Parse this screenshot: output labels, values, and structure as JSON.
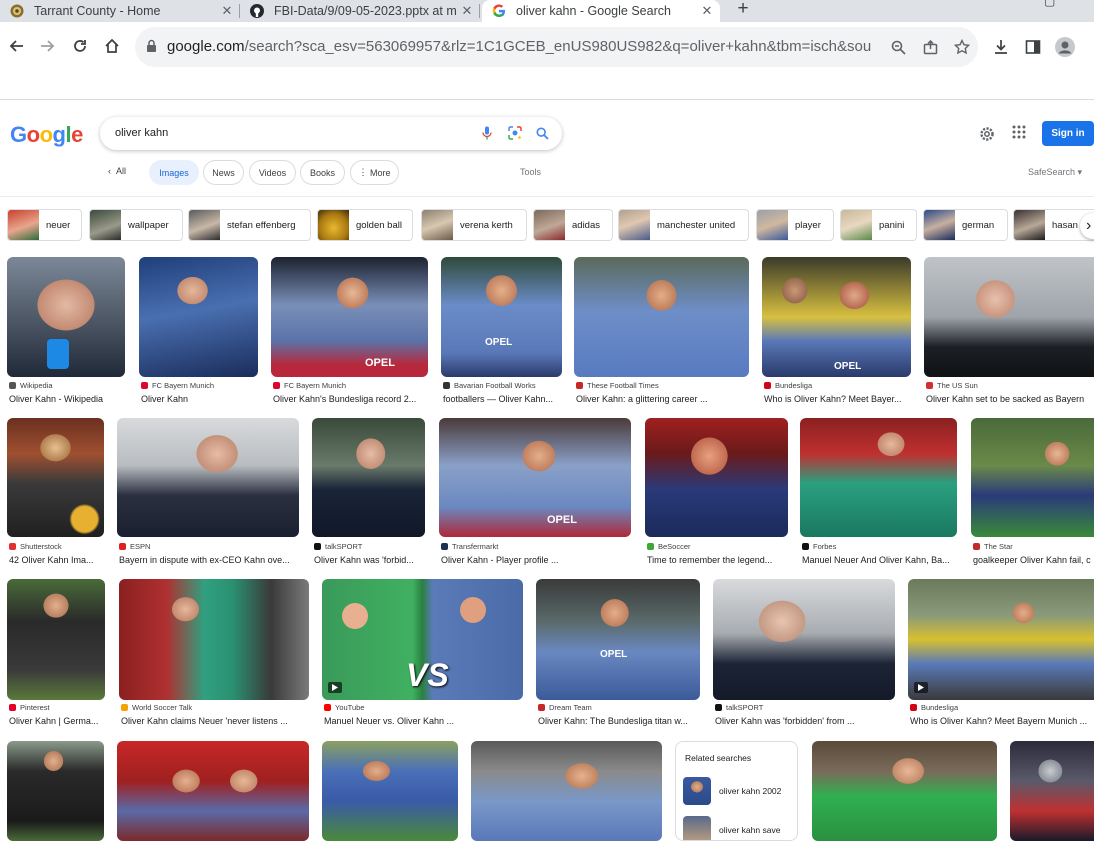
{
  "browser": {
    "tabs": [
      {
        "title": "Tarrant County - Home",
        "favicon": "county-seal-icon"
      },
      {
        "title": "FBI-Data/9/09-05-2023.pptx at m",
        "favicon": "github-icon"
      },
      {
        "title": "oliver kahn - Google Search",
        "favicon": "google-icon",
        "active": true
      }
    ],
    "url_host": "google.com",
    "url_rest": "/search?sca_esv=563069957&rlz=1C1GCEB_enUS980US982&q=oliver+kahn&tbm=isch&source=lnm..."
  },
  "google": {
    "logo": "Google",
    "query": "oliver kahn",
    "signin": "Sign in",
    "filters": {
      "all": "All",
      "images": "Images",
      "news": "News",
      "videos": "Videos",
      "books": "Books",
      "more": "More",
      "tools": "Tools",
      "safesearch": "SafeSearch"
    }
  },
  "chips": [
    "neuer",
    "wallpaper",
    "stefan effenberg",
    "golden ball",
    "verena kerth",
    "adidas",
    "manchester united",
    "player",
    "panini",
    "german",
    "hasan"
  ],
  "results": [
    {
      "source": "Wikipedia",
      "title": "Oliver Kahn - Wikipedia"
    },
    {
      "source": "FC Bayern Munich",
      "title": "Oliver Kahn"
    },
    {
      "source": "FC Bayern Munich",
      "title": "Oliver Kahn's Bundesliga record 2..."
    },
    {
      "source": "Bavarian Football Works",
      "title": "footballers — Oliver Kahn..."
    },
    {
      "source": "These Football Times",
      "title": "Oliver Kahn: a glittering career ..."
    },
    {
      "source": "Bundesliga",
      "title": "Who is Oliver Kahn? Meet Bayer..."
    },
    {
      "source": "The US Sun",
      "title": "Oliver Kahn set to be sacked as Bayern"
    },
    {
      "source": "Shutterstock",
      "title": "42 Oliver Kahn Ima..."
    },
    {
      "source": "ESPN",
      "title": "Bayern in dispute with ex-CEO Kahn ove..."
    },
    {
      "source": "talkSPORT",
      "title": "Oliver Kahn was 'forbid..."
    },
    {
      "source": "Transfermarkt",
      "title": "Oliver Kahn - Player profile ..."
    },
    {
      "source": "BeSoccer",
      "title": "Time to remember the legend..."
    },
    {
      "source": "Forbes",
      "title": "Manuel Neuer And Oliver Kahn, Ba..."
    },
    {
      "source": "The Star",
      "title": "goalkeeper Oliver Kahn fail, c"
    },
    {
      "source": "Pinterest",
      "title": "Oliver Kahn | Germa..."
    },
    {
      "source": "World Soccer Talk",
      "title": "Oliver Kahn claims Neuer 'never listens ..."
    },
    {
      "source": "YouTube",
      "title": "Manuel Neuer vs. Oliver Kahn ..."
    },
    {
      "source": "Dream Team",
      "title": "Oliver Kahn: The Bundesliga titan w..."
    },
    {
      "source": "talkSPORT",
      "title": "Oliver Kahn was 'forbidden' from ..."
    },
    {
      "source": "Bundesliga",
      "title": "Who is Oliver Kahn? Meet Bayern Munich ..."
    }
  ],
  "overlays": {
    "vs": "VS",
    "jersey": "OPEL"
  },
  "related": {
    "heading": "Related searches",
    "items": [
      "oliver kahn 2002",
      "oliver kahn save"
    ]
  }
}
